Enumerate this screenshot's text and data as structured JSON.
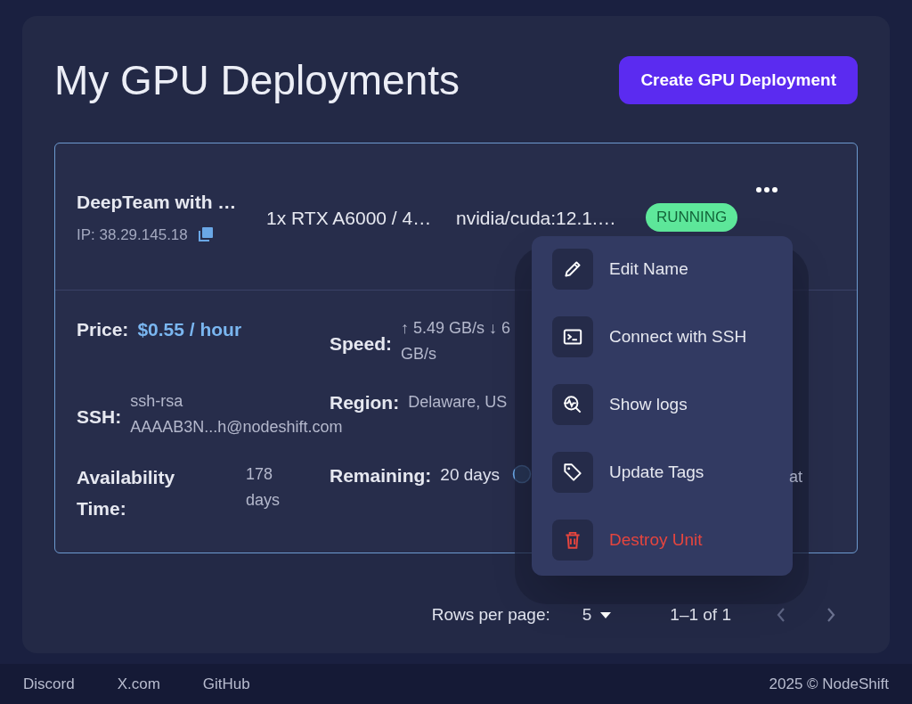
{
  "page_title": "My GPU Deployments",
  "create_button": "Create GPU Deployment",
  "deployment": {
    "name": "DeepTeam with …",
    "ip": "IP: 38.29.145.18",
    "gpu": "1x RTX A6000 / 4…",
    "image": "nvidia/cuda:12.1.…",
    "status": "RUNNING",
    "details": [
      {
        "label": "Price:",
        "value": "$0.55 / hour",
        "kind": "price"
      },
      {
        "label": "Speed:",
        "lines": [
          "↑ 5.49 GB/s ↓ 6",
          "GB/s"
        ],
        "kind": "multi"
      },
      {
        "label": "SSH:",
        "lines": [
          "ssh-rsa",
          "AAAAB3N...h@nodeshift.com"
        ],
        "kind": "multi"
      },
      {
        "label": "Region:",
        "value": "Delaware, US",
        "kind": "plain"
      },
      {
        "label": "Availability Time:",
        "lines": [
          "178",
          "days"
        ],
        "kind": "multi"
      },
      {
        "label": "Remaining:",
        "value": "20 days",
        "kind": "info"
      }
    ],
    "trailing_text": "at"
  },
  "menu": [
    {
      "label": "Edit Name",
      "kind": "edit",
      "danger": false
    },
    {
      "label": "Connect with SSH",
      "kind": "terminal",
      "danger": false
    },
    {
      "label": "Show logs",
      "kind": "logs",
      "danger": false
    },
    {
      "label": "Update Tags",
      "kind": "tag",
      "danger": false
    },
    {
      "label": "Destroy Unit",
      "kind": "trash",
      "danger": true
    }
  ],
  "pagination": {
    "rows_label": "Rows per page:",
    "rows_value": "5",
    "range": "1–1 of 1"
  },
  "footer": {
    "links": [
      "Discord",
      "X.com",
      "GitHub"
    ],
    "copyright": "2025 © NodeShift"
  }
}
